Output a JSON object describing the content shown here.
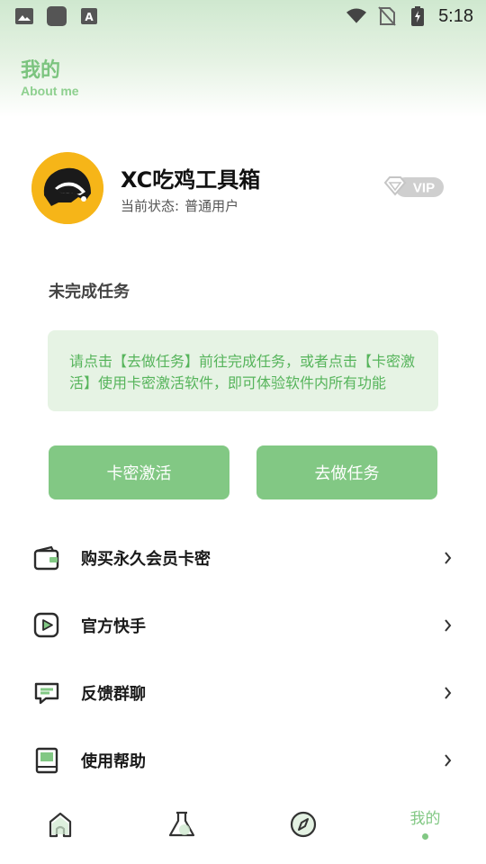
{
  "status_bar": {
    "time": "5:18",
    "icons": [
      "image-icon",
      "app-square-icon",
      "font-a-icon",
      "wifi-icon",
      "no-sim-icon",
      "battery-charging-icon"
    ]
  },
  "header": {
    "title": "我的",
    "subtitle": "About me"
  },
  "profile": {
    "name": "XC吃鸡工具箱",
    "status_label": "当前状态:",
    "status_value": "普通用户",
    "badge": "VIP"
  },
  "tasks": {
    "section_title": "未完成任务",
    "notice": "请点击【去做任务】前往完成任务，或者点击【卡密激活】使用卡密激活软件，即可体验软件内所有功能",
    "activate_button": "卡密激活",
    "do_task_button": "去做任务"
  },
  "menu": {
    "items": [
      {
        "label": "购买永久会员卡密",
        "icon": "wallet-icon"
      },
      {
        "label": "官方快手",
        "icon": "video-play-icon"
      },
      {
        "label": "反馈群聊",
        "icon": "chat-bubble-icon"
      },
      {
        "label": "使用帮助",
        "icon": "book-icon"
      }
    ]
  },
  "bottom_nav": {
    "tabs": [
      {
        "icon": "home-icon"
      },
      {
        "icon": "flask-icon"
      },
      {
        "icon": "compass-icon"
      },
      {
        "label": "我的",
        "active": true
      }
    ]
  },
  "colors": {
    "accent": "#82c884",
    "header_green": "#7cc47f",
    "notice_bg": "#e6f3e4",
    "notice_text": "#56b45b"
  }
}
